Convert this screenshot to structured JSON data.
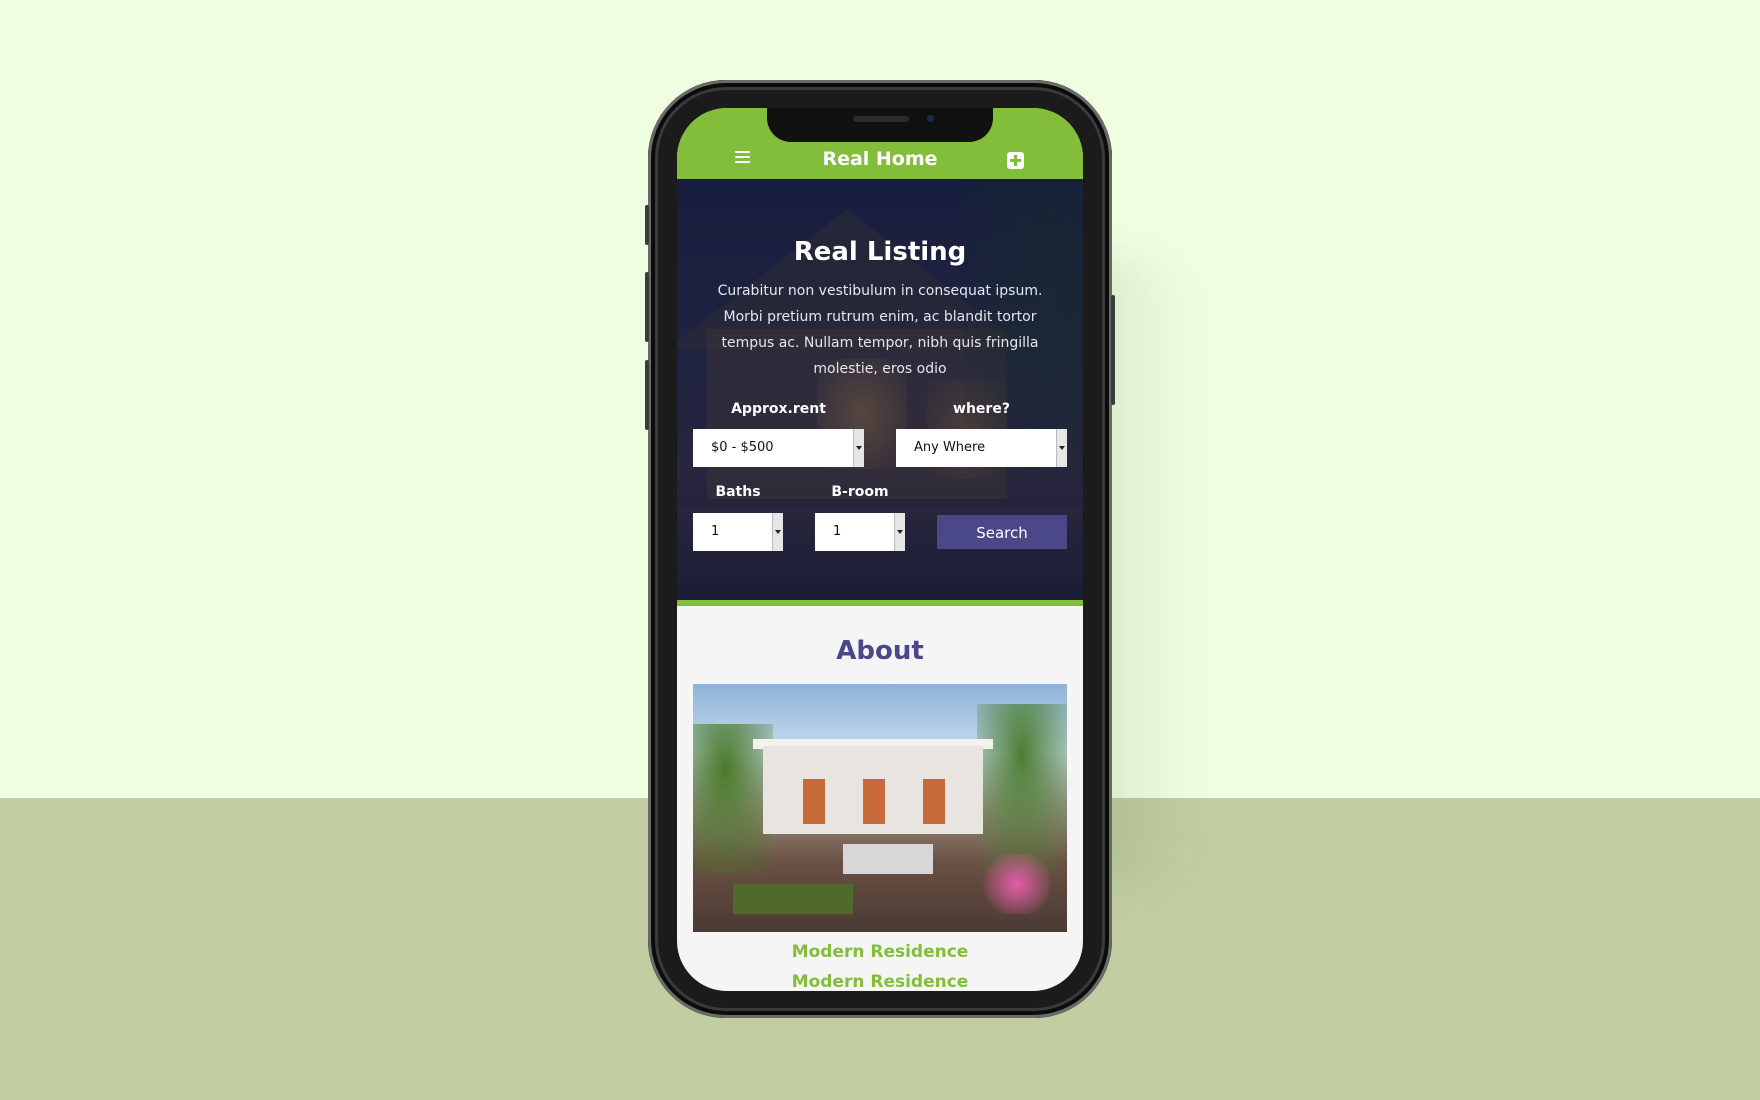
{
  "app": {
    "title": "Real Home",
    "accent_color": "#82be39",
    "brand_color": "#4b4889"
  },
  "topbar": {
    "menu_icon": "hamburger-menu-icon",
    "add_icon": "plus-square-icon"
  },
  "hero": {
    "title": "Real Listing",
    "text": "Curabitur non vestibulum in consequat ipsum. Morbi pretium rutrum enim, ac blandit tortor tempus ac. Nullam tempor, nibh quis fringilla molestie, eros odio"
  },
  "search_form": {
    "rent_label": "Approx.rent",
    "rent_value": "$0 - $500",
    "where_label": "where?",
    "where_value": "Any Where",
    "baths_label": "Baths",
    "baths_value": "1",
    "bedroom_label": "B-room",
    "bedroom_value": "1",
    "search_label": "Search"
  },
  "about": {
    "title": "About",
    "items": [
      "Modern Residence",
      "Modern Residence"
    ]
  }
}
